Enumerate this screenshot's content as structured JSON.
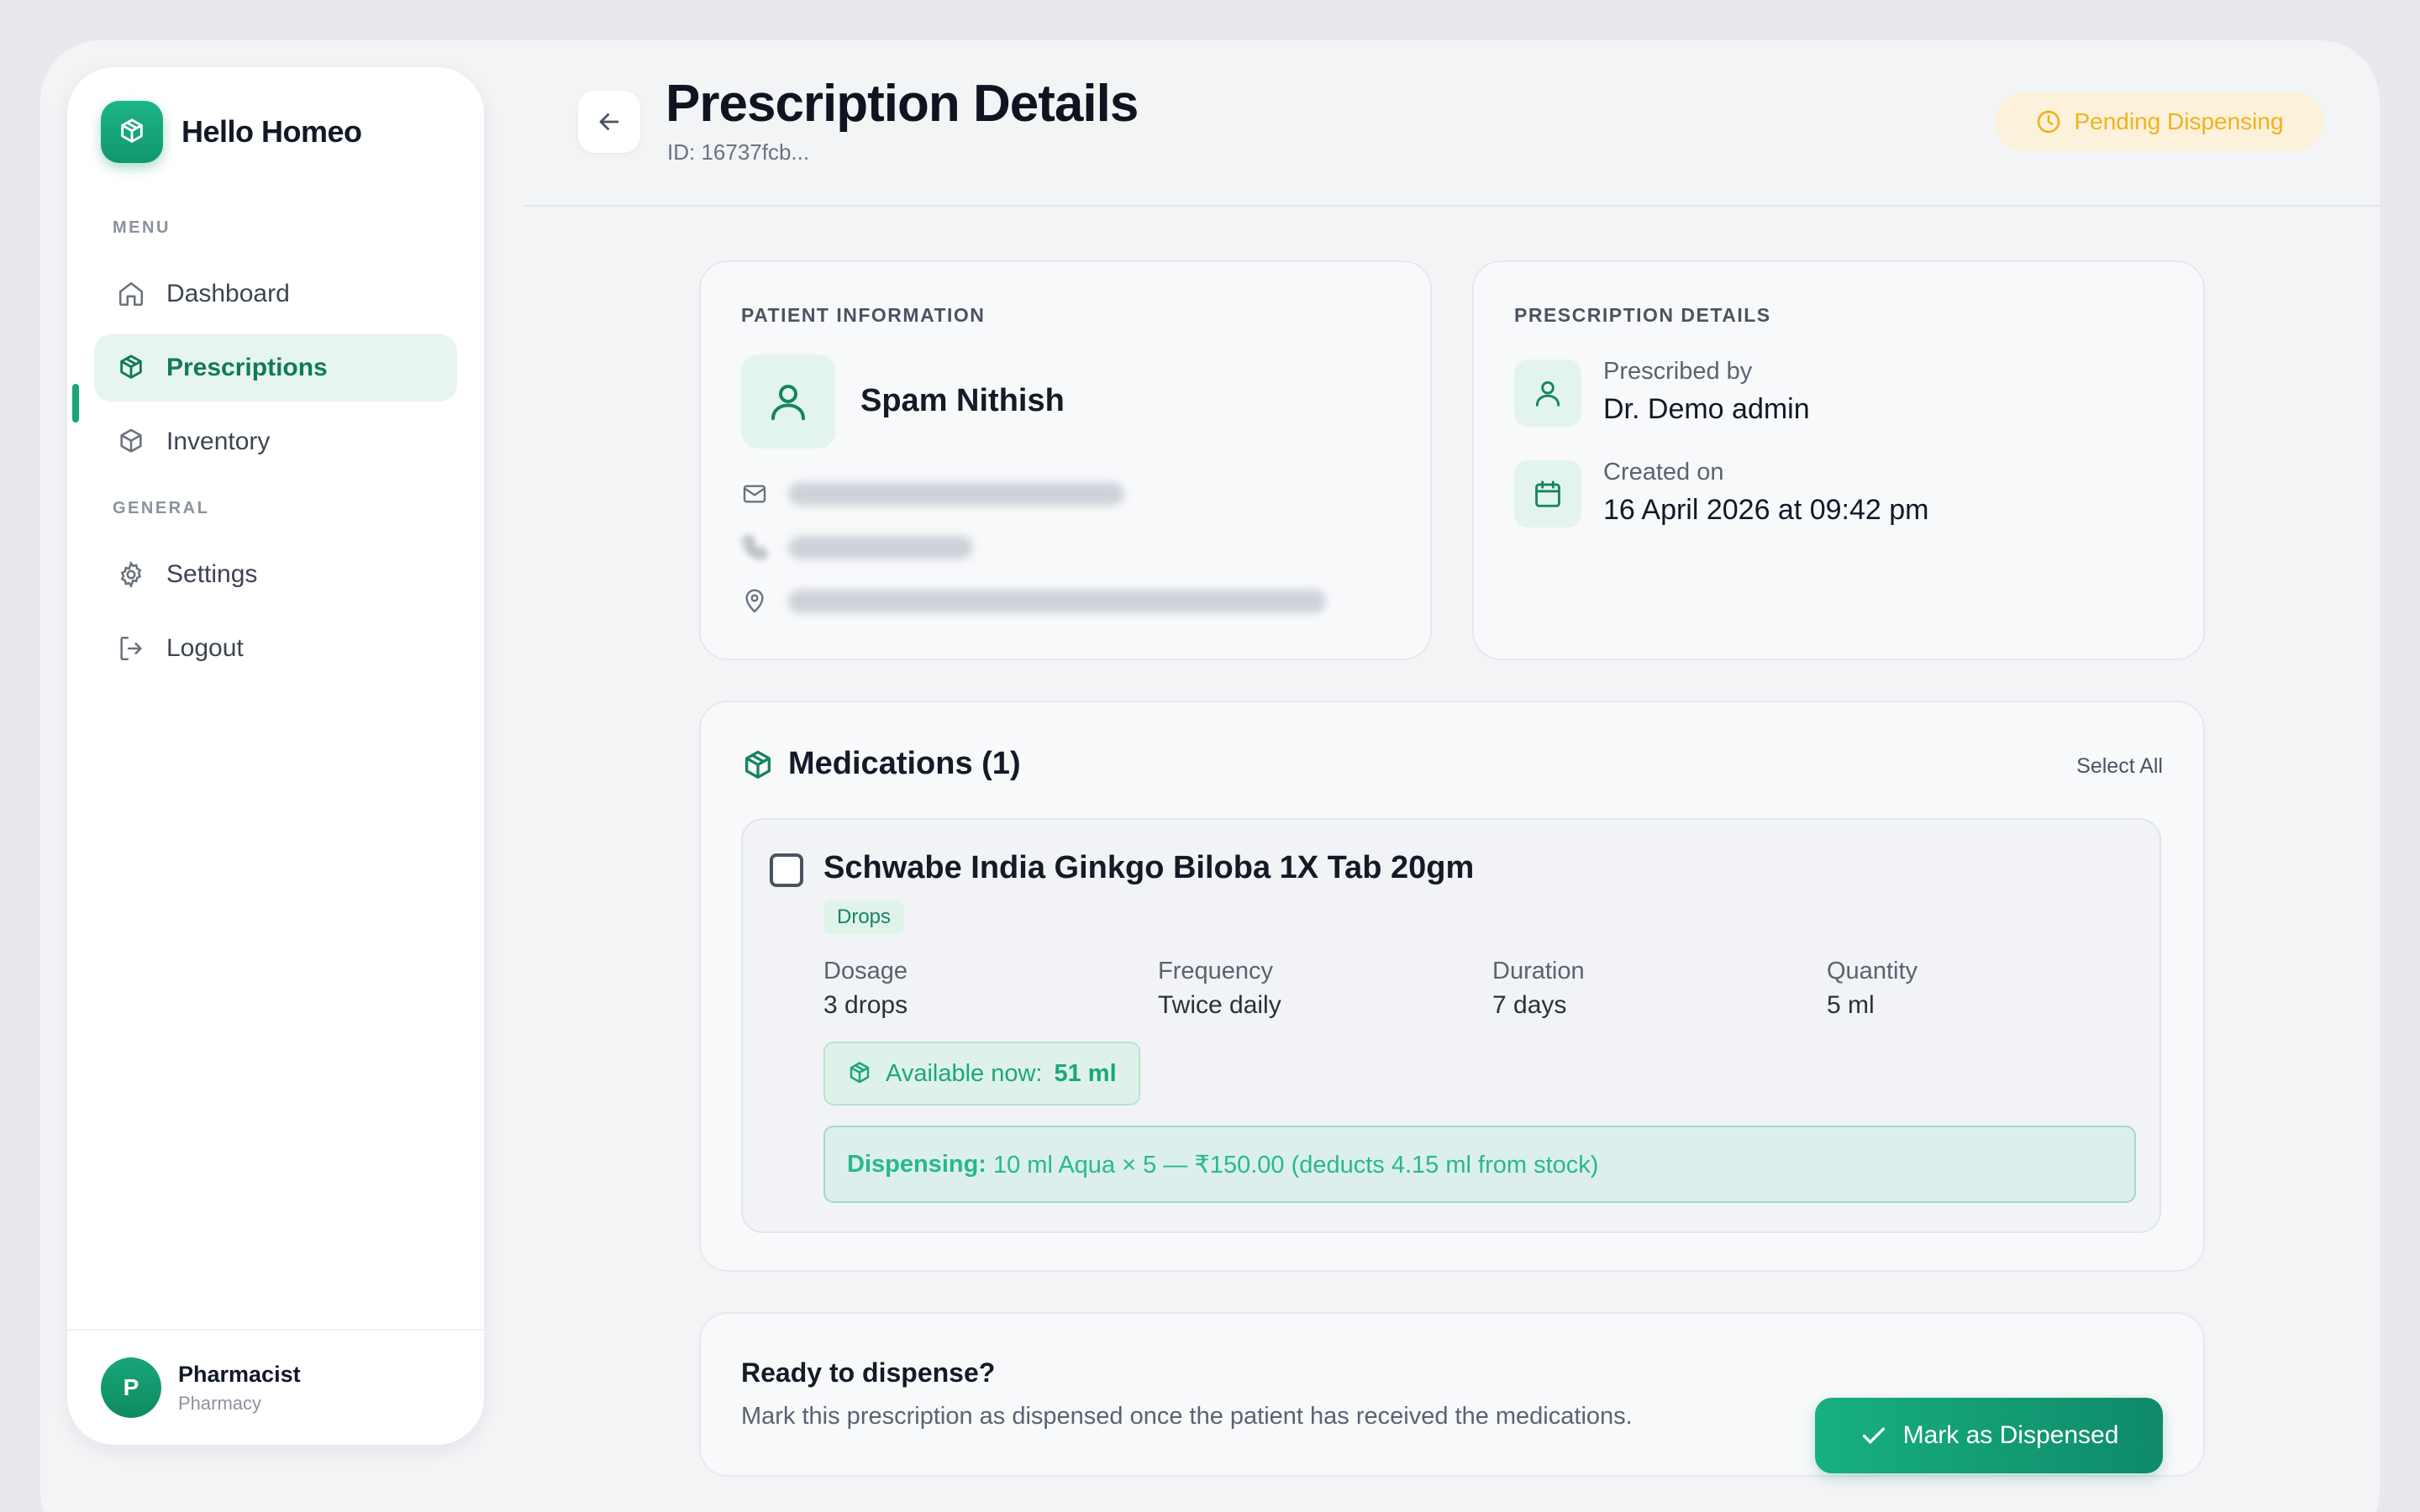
{
  "brand": {
    "name": "Hello Homeo"
  },
  "sidebar": {
    "menu_label": "MENU",
    "general_label": "GENERAL",
    "items": [
      {
        "label": "Dashboard",
        "icon": "home-icon"
      },
      {
        "label": "Prescriptions",
        "icon": "package-icon",
        "active": true
      },
      {
        "label": "Inventory",
        "icon": "box-icon"
      },
      {
        "label": "Settings",
        "icon": "gear-icon"
      },
      {
        "label": "Logout",
        "icon": "logout-icon"
      }
    ],
    "user": {
      "initial": "P",
      "name": "Pharmacist",
      "role": "Pharmacy"
    }
  },
  "header": {
    "title": "Prescription Details",
    "id_text": "ID: 16737fcb...",
    "status": "Pending Dispensing"
  },
  "patient": {
    "section_label": "PATIENT INFORMATION",
    "name": "Spam Nithish"
  },
  "prescription": {
    "section_label": "PRESCRIPTION DETAILS",
    "prescribed_by_label": "Prescribed by",
    "prescribed_by": "Dr. Demo admin",
    "created_label": "Created on",
    "created_on": "16 April 2026 at 09:42 pm"
  },
  "medications": {
    "title": "Medications (1)",
    "select_all": "Select All",
    "items": [
      {
        "name": "Schwabe India Ginkgo Biloba 1X Tab 20gm",
        "tag": "Drops",
        "dosage_label": "Dosage",
        "dosage": "3 drops",
        "frequency_label": "Frequency",
        "frequency": "Twice daily",
        "duration_label": "Duration",
        "duration": "7 days",
        "quantity_label": "Quantity",
        "quantity": "5 ml",
        "available_label": "Available now:",
        "available_value": "51 ml",
        "dispensing_label": "Dispensing:",
        "dispensing_text": "10 ml Aqua × 5 — ₹150.00 (deducts 4.15 ml from stock)"
      }
    ]
  },
  "dispense": {
    "title": "Ready to dispense?",
    "description": "Mark this prescription as dispensed once the patient has received the medications.",
    "button": "Mark as Dispensed"
  },
  "colors": {
    "accent": "#18a676",
    "pending": "#f0b31e",
    "pending_bg": "#fcf1da"
  }
}
